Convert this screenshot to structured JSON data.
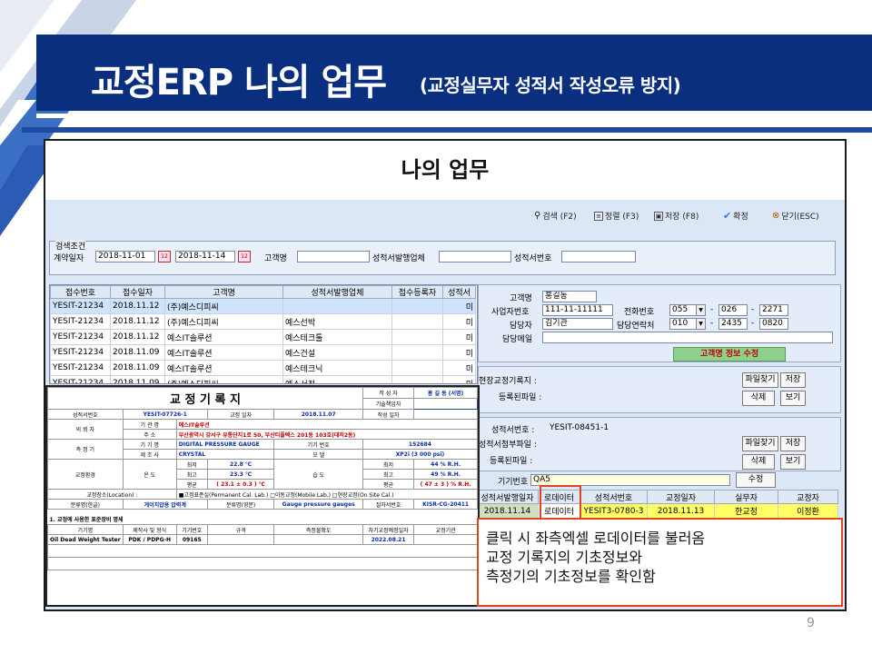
{
  "slide": {
    "title": "교정ERP 나의 업무",
    "subtitle": "(교정실무자 성적서  작성오류 방지)",
    "page_number": "9"
  },
  "window": {
    "title": "나의 업무",
    "toolbar": {
      "search": "검색 (F2)",
      "sort": "정렬 (F3)",
      "save": "저장 (F8)",
      "confirm": "확정",
      "close": "닫기(ESC)"
    },
    "search": {
      "legend": "검색조건",
      "contract_date_label": "계약일자",
      "date_from": "2018-11-01",
      "date_to": "2018-11-14",
      "customer_label": "고객명",
      "customer_value": "",
      "issuer_label": "성적서발행업체",
      "issuer_value": "",
      "cert_no_label": "성적서번호",
      "cert_no_value": ""
    },
    "grid": {
      "headers": [
        "접수번호",
        "접수일자",
        "고객명",
        "성적서발행업체",
        "접수등록자",
        "성적서"
      ],
      "rows": [
        [
          "YESIT-21234",
          "2018.11.12",
          "(주)예스디피씨",
          "",
          "",
          "미"
        ],
        [
          "YESIT-21234",
          "2018.11.12",
          "(주)예스디피씨",
          "예스선박",
          "",
          "미"
        ],
        [
          "YESIT-21234",
          "2018.11.12",
          "예스IT솔루션",
          "예스테크툴",
          "",
          "미"
        ],
        [
          "YESIT-21234",
          "2018.11.09",
          "예스IT솔루션",
          "예스건설",
          "",
          "미"
        ],
        [
          "YESIT-21234",
          "2018.11.09",
          "예스IT솔루션",
          "예스테크닉",
          "",
          "미"
        ],
        [
          "YESIT-21234",
          "2018.11.09",
          "(주)예스디피씨",
          "예스서적",
          "",
          "미"
        ]
      ]
    },
    "customer": {
      "name_label": "고객명",
      "name_value": "홍길동",
      "bizno_label": "사업자번호",
      "bizno_value": "111-11-11111",
      "phone_label": "전화번호",
      "phone_a": "055",
      "phone_b": "026",
      "phone_c": "2271",
      "manager_label": "담당자",
      "manager_value": "김기관",
      "mphone_label": "담당연락처",
      "mphone_a": "010",
      "mphone_b": "2435",
      "mphone_c": "0820",
      "email_label": "담당메일",
      "email_value": "",
      "edit_button": "고객명 정보 수정"
    },
    "field_record": {
      "label": "현장교정기록지 :",
      "reg_file_label": "등록된파일 :",
      "find_button": "파일찾기",
      "save_button": "저장",
      "delete_button": "삭제",
      "view_button": "보기"
    },
    "cert": {
      "cert_no_label": "성적서번호 :",
      "cert_no_value": "YESIT-08451-1",
      "attach_label": "성적서첨부파일 :",
      "reg_file_label": "등록된파일 :",
      "find_button": "파일찾기",
      "save_button": "저장",
      "delete_button": "삭제",
      "view_button": "보기"
    },
    "equipment": {
      "label": "기기번호",
      "value": "QA5",
      "edit_button": "수정",
      "headers": [
        "성적서발행일자",
        "로데이터",
        "성적서번호",
        "교정일자",
        "실무자",
        "교정자"
      ],
      "row": [
        "2018.11.14",
        "로데이터",
        "YESIT3-0780-3",
        "2018.11.13",
        "한교정",
        "이정환"
      ]
    }
  },
  "record": {
    "title": "교 정  기 록 지",
    "author_label": "작 성 자",
    "author_value": "홍 길 동  (서명)",
    "tech_manager_label": "기술책임자",
    "cert_no_label": "성적서번호",
    "cert_no_value": "YESIT-07726-1",
    "cal_date_label": "교정 일자",
    "cal_date_value": "2018.11.07",
    "write_date_label": "작성 일자",
    "client_label": "의 뢰 자",
    "org_label": "기 관 명",
    "org_value": "예스IT솔루션",
    "addr_label": "주     소",
    "addr_value": "부산광역시 강서구 유통단지1로 50, 부산티플렉스 201동 103호(대저2동)",
    "device_label": "측 정 기",
    "model_name_label": "기 기 명",
    "model_name_value": "DIGITAL PRESSURE GAUGE",
    "device_no_label": "기기 번호",
    "device_no_value": "152684",
    "maker_label": "제 조 사",
    "maker_value": "CRYSTAL",
    "model_label": "모     델",
    "model_value": "XP2i (3 000 psi)",
    "env_label": "교정환경",
    "temp_label": "온     도",
    "humid_label": "습     도",
    "min_label": "최저",
    "max_label": "최고",
    "avg_label": "평균",
    "temp_min": "22.8 ℃",
    "temp_max": "23.3 ℃",
    "temp_avg": "( 23.1 ± 0.3 ) ℃",
    "hum_min": "44  % R.H.",
    "hum_max": "49  % R.H.",
    "hum_avg": "( 47 ± 3 ) % R.H.",
    "place_label": "교정장소(Location) :",
    "place_value": "■고정표준실(Permanent Cal. Lab.)  □이동교정(Mobile Lab.)  □현장교정(On Site Cal.)",
    "cls_kr_label": "분류명(한글)",
    "cls_kr_value": "게이지압용 압력계",
    "cls_en_label": "분류명(영문)",
    "cls_en_value": "Gauge pressure gauges",
    "proc_label": "절차서번호",
    "proc_value": "KISR-CG-20411",
    "std_section": "1. 교정에 사용한 표준장비 명세",
    "std_headers": [
      "기기명",
      "제작사 및 형식",
      "기기번호",
      "규격",
      "측정불확도",
      "차기교정예정일자",
      "교정기관"
    ],
    "std_row": [
      "Oil Dead Weight Tester",
      "PDK / PDPG-H",
      "09165",
      "",
      "",
      "2022.08.21",
      ""
    ]
  },
  "callout": {
    "line1": "클릭 시 좌측엑셀 로데이터를 불러옴",
    "line2": "교정 기록지의 기초정보와",
    "line3": "측정기의 기초정보를 확인함"
  },
  "colors": {
    "banner": "#0a2f7e",
    "accent_orange": "#e0451f",
    "window_bg": "#dbe7f6"
  }
}
